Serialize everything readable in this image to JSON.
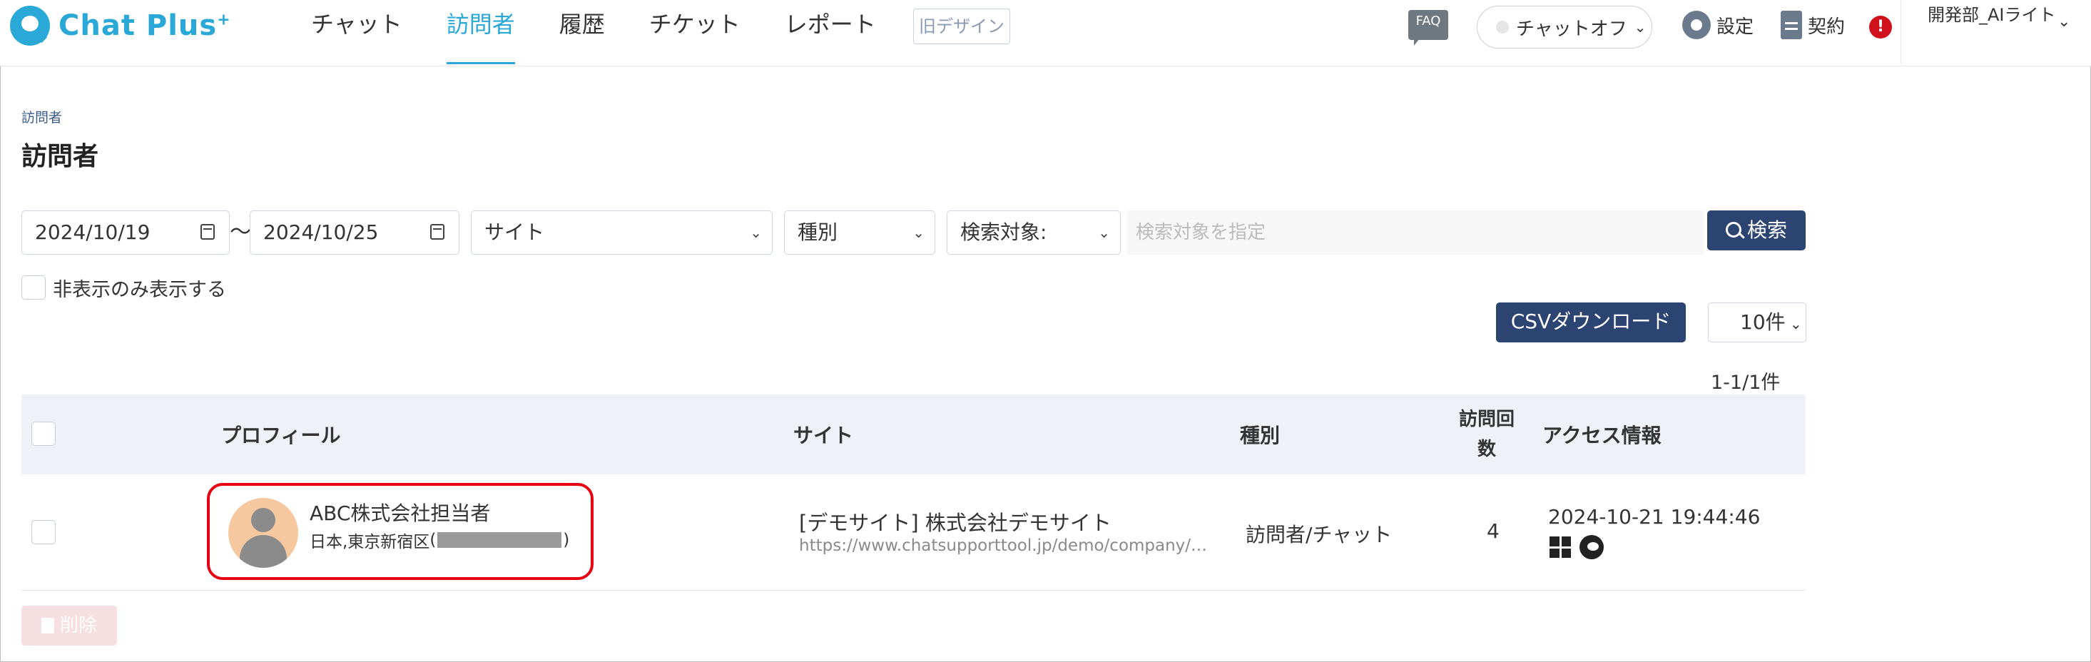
{
  "header": {
    "logo_text": "Chat Plus",
    "logo_sup": "+",
    "nav": [
      "チャット",
      "訪問者",
      "履歴",
      "チケット",
      "レポート"
    ],
    "active_nav": "訪問者",
    "old_design": "旧デザイン",
    "faq": "FAQ",
    "chat_status": "チャットオフ",
    "settings": "設定",
    "contract": "契約",
    "alert": "!",
    "user": "開発部_AIライト"
  },
  "page": {
    "breadcrumb": "訪問者",
    "title": "訪問者"
  },
  "filters": {
    "date_from": "2024/10/19",
    "tilde": "〜",
    "date_to": "2024/10/25",
    "site": "サイト",
    "type": "種別",
    "search_target": "検索対象:",
    "search_placeholder": "検索対象を指定",
    "search_button": "検索",
    "hidden_only": "非表示のみ表示する"
  },
  "toolbar": {
    "csv_button": "CSVダウンロード",
    "per_page": "10件",
    "count": "1-1/1件"
  },
  "table": {
    "headers": [
      "プロフィール",
      "サイト",
      "種別",
      "訪問回数",
      "アクセス情報"
    ],
    "rows": [
      {
        "name": "ABC株式会社担当者",
        "location": "日本,東京新宿区",
        "site_name": "[デモサイト] 株式会社デモサイト",
        "site_url": "https://www.chatsupporttool.jp/demo/company/…",
        "type": "訪問者/チャット",
        "visits": "4",
        "access_time": "2024-10-21 19:44:46",
        "os_icon": "windows-icon",
        "browser_icon": "edge-icon"
      }
    ]
  },
  "actions": {
    "delete": "削除"
  },
  "colors": {
    "accent": "#2aa8d8",
    "primary_button": "#2c4472",
    "highlight": "#e60012",
    "alert": "#d0101b"
  }
}
